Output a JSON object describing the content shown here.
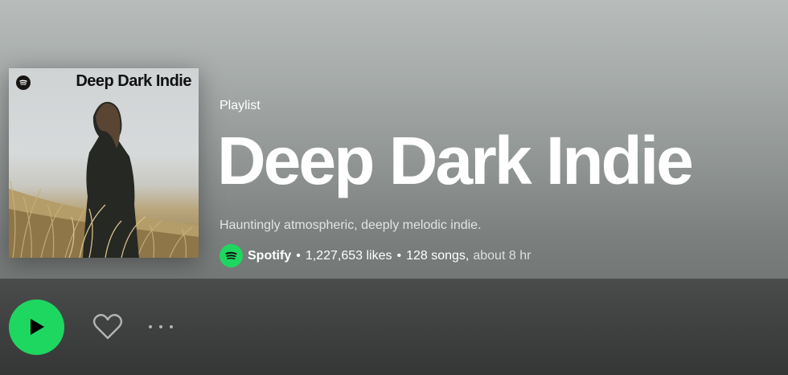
{
  "playlist": {
    "type_label": "Playlist",
    "title": "Deep Dark Indie",
    "description": "Hauntingly atmospheric, deeply melodic indie.",
    "owner": "Spotify",
    "likes": "1,227,653 likes",
    "songs": "128 songs,",
    "duration": "about 8 hr",
    "separator": "•"
  },
  "cover": {
    "title": "Deep Dark Indie",
    "logo_icon": "spotify-logo-icon"
  },
  "actions": {
    "play_icon": "play-icon",
    "like_icon": "heart-outline-icon",
    "more_icon": "more-options-icon"
  },
  "colors": {
    "accent": "#1ed760",
    "hero_gradient_top": "#b8bdbb",
    "hero_gradient_bottom": "#737776",
    "action_bar": "#3f4141"
  }
}
